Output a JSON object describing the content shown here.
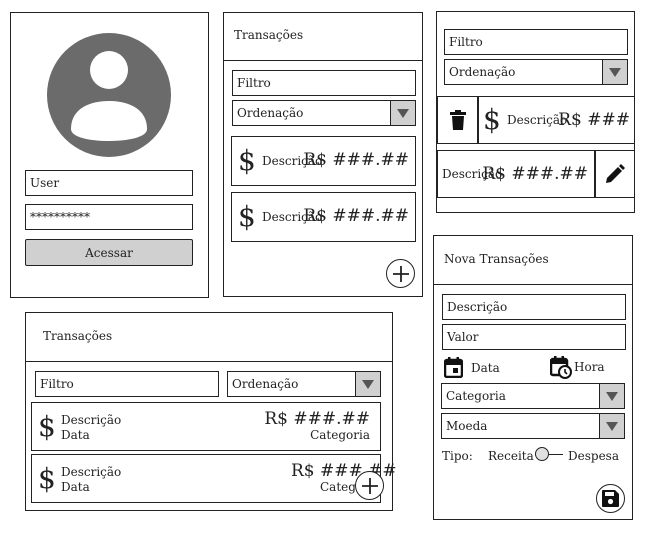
{
  "login": {
    "user_placeholder": "User",
    "password_value": "**********",
    "submit_label": "Acessar"
  },
  "list_panel": {
    "title": "Transações",
    "filter_placeholder": "Filtro",
    "sort_label": "Ordenação",
    "items": [
      {
        "description": "Descrição",
        "amount": "R$ ###.##"
      },
      {
        "description": "Descrição",
        "amount": "R$ ###.##"
      }
    ]
  },
  "swipe_panel": {
    "filter_placeholder": "Filtro",
    "sort_label": "Ordenação",
    "delete_item": {
      "description": "Descrição",
      "amount": "R$ ###"
    },
    "edit_item": {
      "description": "Descrição",
      "amount": "R$ ###.##"
    }
  },
  "wide_panel": {
    "title": "Transações",
    "filter_placeholder": "Filtro",
    "sort_label": "Ordenação",
    "items": [
      {
        "description": "Descrição",
        "date": "Data",
        "amount": "R$ ###.##",
        "category": "Categoria"
      },
      {
        "description": "Descrição",
        "date": "Data",
        "amount": "R$ ###.##",
        "category": "Catego"
      }
    ]
  },
  "new_panel": {
    "title": "Nova Transações",
    "description_placeholder": "Descrição",
    "value_placeholder": "Valor",
    "date_label": "Data",
    "time_label": "Hora",
    "category_label": "Categoria",
    "currency_label": "Moeda",
    "type_label": "Tipo:",
    "income_label": "Receita",
    "expense_label": "Despesa"
  },
  "colors": {
    "avatar": "#6b6b6b",
    "button_bg": "#d0d0d0",
    "border": "#222222"
  }
}
